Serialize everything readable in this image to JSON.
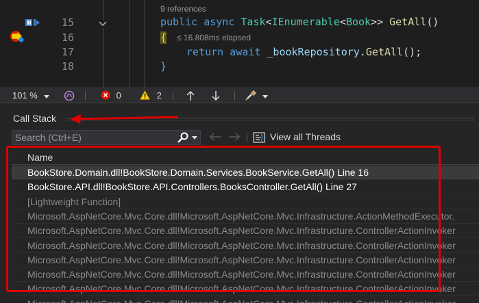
{
  "editor": {
    "references": "9 references",
    "elapsed": "≤ 16.808ms elapsed",
    "line_numbers": [
      "15",
      "16",
      "17",
      "18"
    ],
    "code": {
      "l15_kw1": "public",
      "l15_kw2": "async",
      "l15_type1": "Task",
      "l15_p1": "<",
      "l15_type2": "IEnumerable",
      "l15_p2": "<",
      "l15_type3": "Book",
      "l15_p3": ">>",
      "l15_meth": "GetAll",
      "l15_p4": "()",
      "l16_brace": "{",
      "l17_kw1": "return",
      "l17_kw2": "await",
      "l17_field": "_bookRepository",
      "l17_dot": ".",
      "l17_meth": "GetAll",
      "l17_end": "();",
      "l18_brace": "}"
    }
  },
  "statusbar": {
    "zoom": "101 %",
    "errors": "0",
    "warnings": "2"
  },
  "callstack": {
    "title": "Call Stack",
    "search_placeholder": "Search (Ctrl+E)",
    "view_all_threads": "View all Threads",
    "column_name": "Name",
    "rows": [
      {
        "text": "BookStore.Domain.dll!BookStore.Domain.Services.BookService.GetAll() Line 16",
        "color": "#ffffff"
      },
      {
        "text": "BookStore.API.dll!BookStore.API.Controllers.BooksController.GetAll() Line 27",
        "color": "#ffffff"
      },
      {
        "text": "[Lightweight Function]",
        "color": "#8a8a8a"
      },
      {
        "text": "Microsoft.AspNetCore.Mvc.Core.dll!Microsoft.AspNetCore.Mvc.Infrastructure.ActionMethodExecutor.",
        "color": "#8a8a8a"
      },
      {
        "text": "Microsoft.AspNetCore.Mvc.Core.dll!Microsoft.AspNetCore.Mvc.Infrastructure.ControllerActionInvoker",
        "color": "#8a8a8a"
      },
      {
        "text": "Microsoft.AspNetCore.Mvc.Core.dll!Microsoft.AspNetCore.Mvc.Infrastructure.ControllerActionInvoker",
        "color": "#8a8a8a"
      },
      {
        "text": "Microsoft.AspNetCore.Mvc.Core.dll!Microsoft.AspNetCore.Mvc.Infrastructure.ControllerActionInvoker",
        "color": "#8a8a8a"
      },
      {
        "text": "Microsoft.AspNetCore.Mvc.Core.dll!Microsoft.AspNetCore.Mvc.Infrastructure.ControllerActionInvoker",
        "color": "#8a8a8a"
      },
      {
        "text": "Microsoft.AspNetCore.Mvc.Core.dll!Microsoft.AspNetCore.Mvc.Infrastructure.ControllerActionInvoker",
        "color": "#8a8a8a"
      },
      {
        "text": "Microsoft.AspNetCore.Mvc.Core.dll!Microsoft.AspNetCore.Mvc.Infrastructure.ControllerActionInvoker",
        "color": "#8a8a8a"
      }
    ]
  },
  "colors": {
    "annotation": "#e00000",
    "keyword": "#569cd6",
    "type": "#4ec9b0",
    "method": "#dcdcaa",
    "field": "#9cdcfe"
  },
  "icons": [
    "codelens-icon",
    "breakpoint-current-icon",
    "fold-chevron-icon",
    "glyph-icon",
    "error-icon",
    "warning-icon",
    "arrow-up-icon",
    "arrow-down-icon",
    "brush-icon",
    "search-icon",
    "arrow-left-icon",
    "arrow-right-icon",
    "threads-icon",
    "current-frame-arrow-icon"
  ]
}
